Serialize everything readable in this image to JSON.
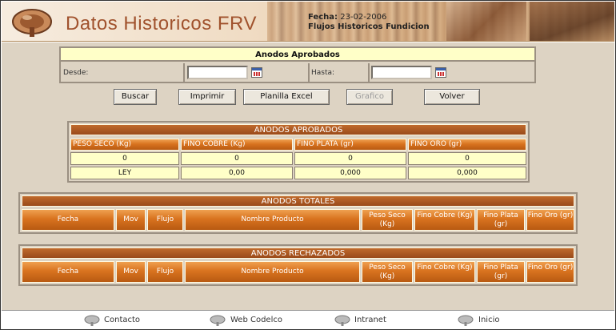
{
  "header": {
    "title": "Datos Historicos FRV",
    "fecha_label": "Fecha:",
    "fecha_value": "23-02-2006",
    "subtitle": "Flujos Historicos Fundicion"
  },
  "filters": {
    "title": "Anodos Aprobados",
    "desde_label": "Desde:",
    "desde_value": "",
    "hasta_label": "Hasta:",
    "hasta_value": ""
  },
  "buttons": {
    "buscar": "Buscar",
    "imprimir": "Imprimir",
    "planilla_excel": "Planilla Excel",
    "grafico": "Grafico",
    "volver": "Volver"
  },
  "aprobados": {
    "title": "ANODOS APROBADOS",
    "headers": [
      "PESO SECO (Kg)",
      "FINO COBRE (Kg)",
      "FINO PLATA (gr)",
      "FINO ORO (gr)"
    ],
    "row1": [
      "0",
      "0",
      "0",
      "0"
    ],
    "row2": [
      "LEY",
      "0,00",
      "0,000",
      "0,000"
    ]
  },
  "totales": {
    "title": "ANODOS TOTALES",
    "headers": [
      "Fecha",
      "Mov",
      "Flujo",
      "Nombre Producto",
      "Peso Seco (Kg)",
      "Fino Cobre (Kg)",
      "Fino Plata (gr)",
      "Fino Oro (gr)"
    ]
  },
  "rechazados": {
    "title": "ANODOS RECHAZADOS",
    "headers": [
      "Fecha",
      "Mov",
      "Flujo",
      "Nombre Producto",
      "Peso Seco (Kg)",
      "Fino Cobre (Kg)",
      "Fino Plata (gr)",
      "Fino Oro (gr)"
    ]
  },
  "footer": {
    "links": [
      "Contacto",
      "Web Codelco",
      "Intranet",
      "Inicio"
    ]
  },
  "colors": {
    "accent_orange": "#d9731f",
    "title_brown": "#a0522d",
    "panel_bg": "#ddd3c3",
    "highlight_yellow": "#ffffc8"
  }
}
